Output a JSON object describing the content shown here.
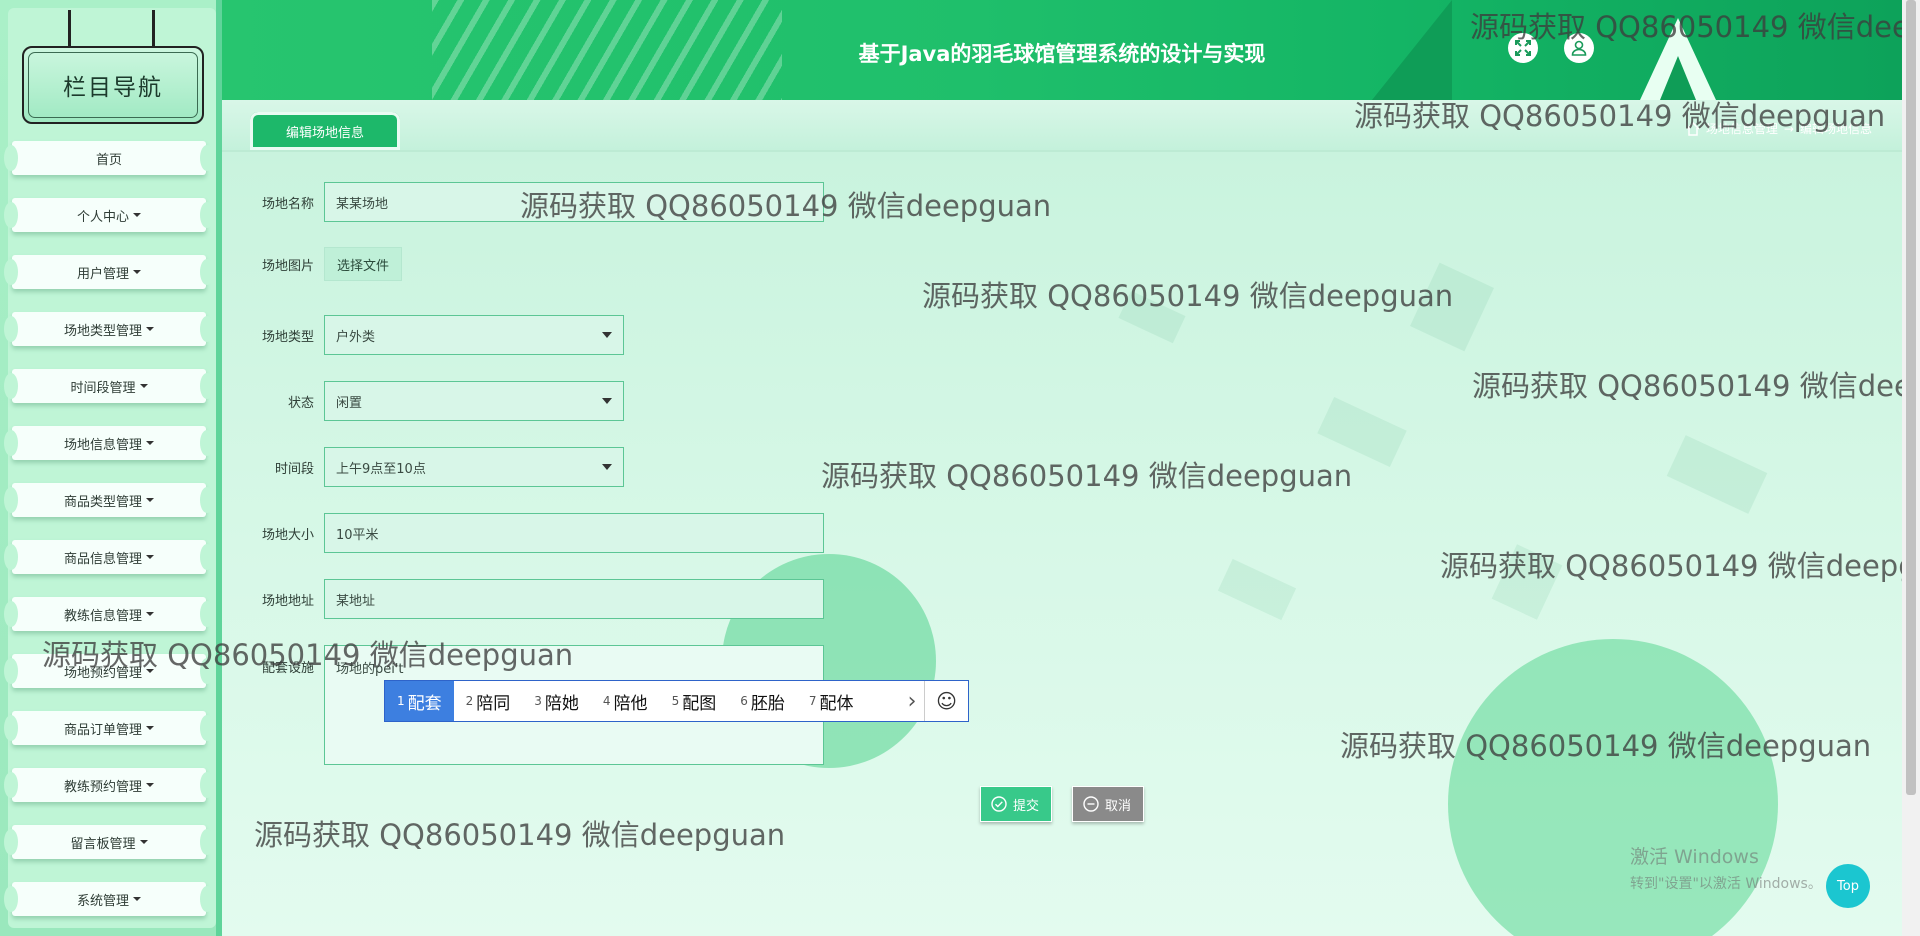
{
  "app": {
    "title": "基于Java的羽毛球馆管理系统的设计与实现"
  },
  "sidebar": {
    "heading": "栏目导航",
    "items": [
      {
        "label": "首页",
        "has_caret": false
      },
      {
        "label": "个人中心",
        "has_caret": true
      },
      {
        "label": "用户管理",
        "has_caret": true
      },
      {
        "label": "场地类型管理",
        "has_caret": true
      },
      {
        "label": "时间段管理",
        "has_caret": true
      },
      {
        "label": "场地信息管理",
        "has_caret": true
      },
      {
        "label": "商品类型管理",
        "has_caret": true
      },
      {
        "label": "商品信息管理",
        "has_caret": true
      },
      {
        "label": "教练信息管理",
        "has_caret": true
      },
      {
        "label": "场地预约管理",
        "has_caret": true
      },
      {
        "label": "商品订单管理",
        "has_caret": true
      },
      {
        "label": "教练预约管理",
        "has_caret": true
      },
      {
        "label": "留言板管理",
        "has_caret": true
      },
      {
        "label": "系统管理",
        "has_caret": true
      }
    ]
  },
  "header": {
    "fullscreen_icon": "expand-icon",
    "user_icon": "user-icon"
  },
  "tabbar": {
    "active_tab": "编辑场地信息",
    "breadcrumb": {
      "home_icon": "home-icon",
      "parent": "场地信息管理",
      "separator": "→",
      "current": "编辑场地信息"
    }
  },
  "form": {
    "name": {
      "label": "场地名称",
      "value": "某某场地"
    },
    "image": {
      "label": "场地图片",
      "button": "选择文件"
    },
    "type": {
      "label": "场地类型",
      "value": "户外类"
    },
    "status": {
      "label": "状态",
      "value": "闲置"
    },
    "timeslot": {
      "label": "时间段",
      "value": "上午9点至10点"
    },
    "size": {
      "label": "场地大小",
      "value": "10平米"
    },
    "address": {
      "label": "场地地址",
      "value": "某地址"
    },
    "facilities": {
      "label": "配套设施",
      "value": "场地的pei't"
    }
  },
  "ime": {
    "candidates": [
      {
        "num": "1",
        "text": "配套",
        "selected": true
      },
      {
        "num": "2",
        "text": "陪同"
      },
      {
        "num": "3",
        "text": "陪她"
      },
      {
        "num": "4",
        "text": "陪他"
      },
      {
        "num": "5",
        "text": "配图"
      },
      {
        "num": "6",
        "text": "胚胎"
      },
      {
        "num": "7",
        "text": "配体"
      }
    ],
    "next_icon": "chevron-right-icon",
    "emoji_icon": "smiley-icon"
  },
  "actions": {
    "submit": "提交",
    "cancel": "取消"
  },
  "watermark": "源码获取 QQ86050149 微信deepguan",
  "activation": {
    "line1": "激活 Windows",
    "line2": "转到\"设置\"以激活 Windows。"
  },
  "top_button": "Top",
  "colors": {
    "primary": "#1db86a",
    "header_dark": "#0da25a",
    "ime_selected": "#3d7fe0",
    "top_button": "#1bc6d0"
  }
}
